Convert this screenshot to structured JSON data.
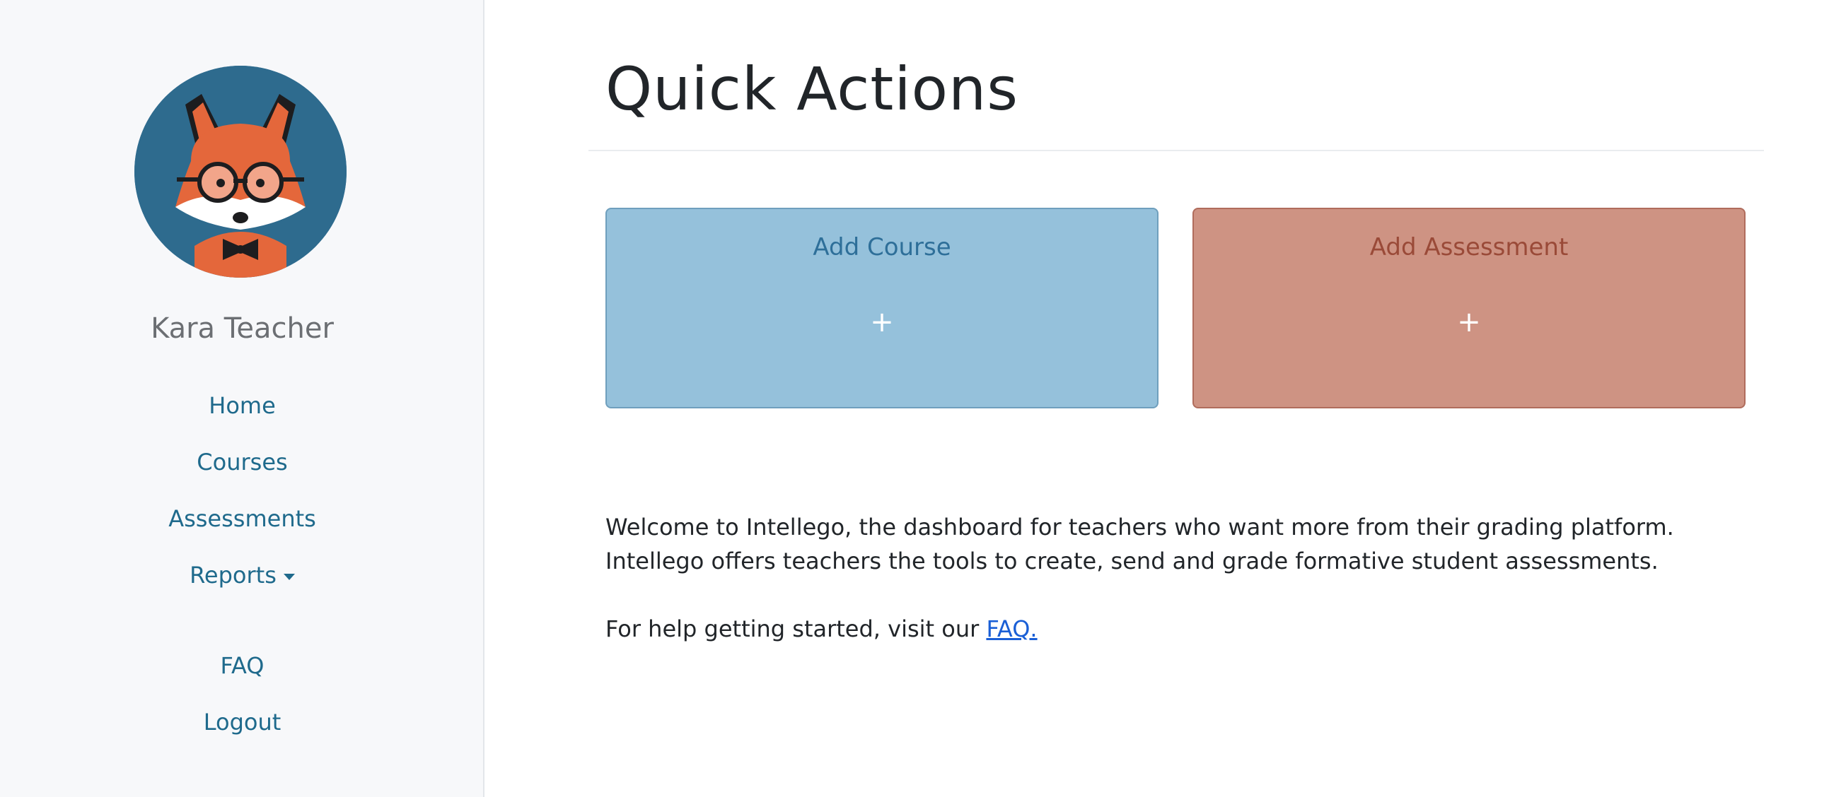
{
  "sidebar": {
    "avatar_icon": "fox-avatar-icon",
    "user_name": "Kara Teacher",
    "nav": {
      "home": "Home",
      "courses": "Courses",
      "assessments": "Assessments",
      "reports": "Reports",
      "faq": "FAQ",
      "logout": "Logout"
    }
  },
  "main": {
    "title": "Quick Actions",
    "cards": {
      "add_course": {
        "label": "Add Course",
        "plus": "+"
      },
      "add_assessment": {
        "label": "Add Assessment",
        "plus": "+"
      }
    },
    "welcome_line1": "Welcome to Intellego, the dashboard for teachers who want more from their grading platform.",
    "welcome_line2": "Intellego offers teachers the tools to create, send and grade formative student assessments.",
    "help_text": "For help getting started, visit our",
    "help_link": "FAQ."
  },
  "colors": {
    "sidebar_bg": "#f7f8fa",
    "nav_link": "#1f6a8c",
    "course_card": "#95c1db",
    "assessment_card": "#ce9383",
    "link": "#1a5fd6"
  }
}
